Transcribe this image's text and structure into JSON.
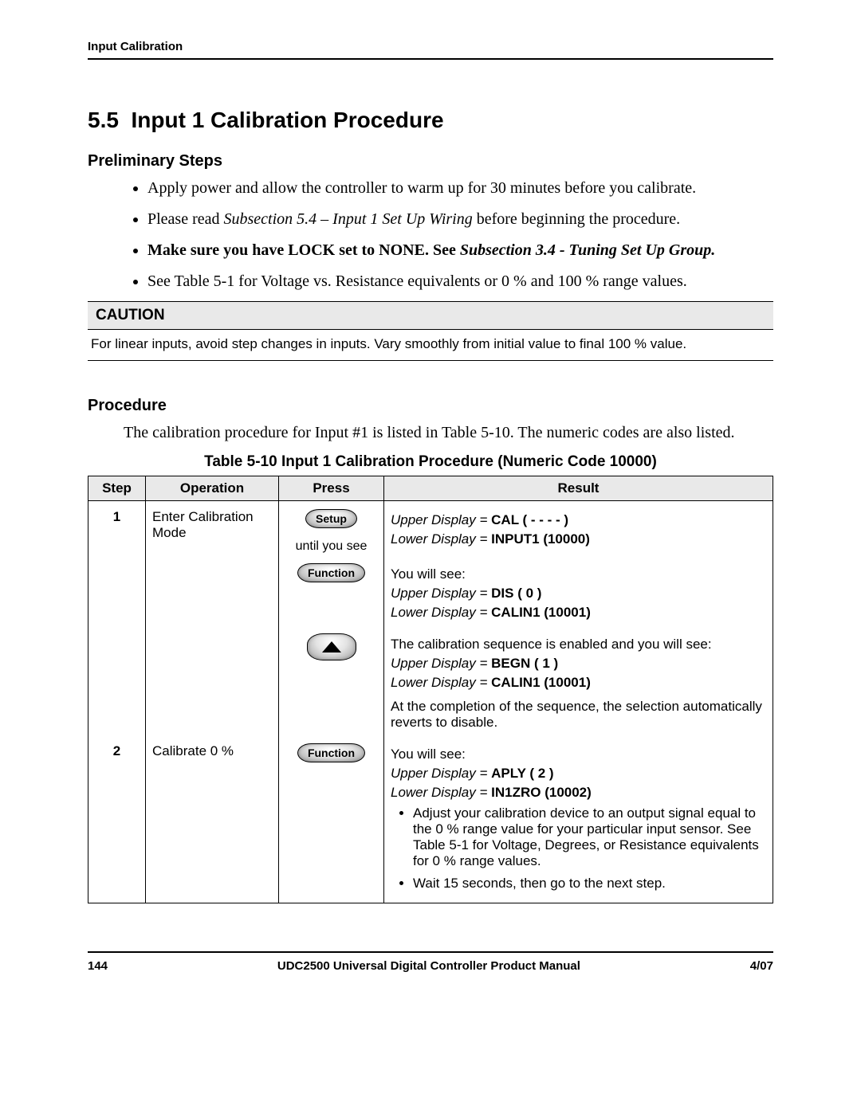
{
  "header": {
    "running": "Input Calibration"
  },
  "section": {
    "number": "5.5",
    "title": "Input 1 Calibration Procedure"
  },
  "prelim": {
    "heading": "Preliminary Steps",
    "b1": "Apply power and allow the controller to warm up for 30 minutes before you calibrate.",
    "b2_a": "Please read ",
    "b2_i": "Subsection 5.4 – Input 1 Set Up Wiring",
    "b2_b": " before beginning the procedure.",
    "b3_a": "Make sure you have LOCK set to NONE. See ",
    "b3_i": "Subsection 3.4 - Tuning Set Up Group.",
    "b4": "See Table 5-1 for Voltage vs. Resistance equivalents or 0 % and 100 % range values."
  },
  "caution": {
    "label": "CAUTION",
    "body": "For linear inputs, avoid step changes in inputs. Vary smoothly from initial value to final 100 % value."
  },
  "procedure": {
    "heading": "Procedure",
    "intro": "The calibration procedure for Input #1 is listed in Table 5-10. The numeric codes are also listed.",
    "table_caption": "Table 5-10  Input 1 Calibration Procedure (Numeric Code 10000)"
  },
  "table": {
    "hdr_step": "Step",
    "hdr_op": "Operation",
    "hdr_press": "Press",
    "hdr_result": "Result"
  },
  "buttons": {
    "setup": "Setup",
    "function": "Function",
    "up_name": "up-arrow-button"
  },
  "row1": {
    "step": "1",
    "op": "Enter Calibration Mode",
    "until": "until you see",
    "res1_a": "Upper Display = ",
    "res1_b": "CAL ( - - - - )",
    "res1_c": "Lower Display = ",
    "res1_d": "INPUT1 (10000)",
    "res2_a": "You will see:",
    "res2_b": "Upper Display = ",
    "res2_c": "DIS ( 0 )",
    "res2_d": "Lower Display = ",
    "res2_e": "CALIN1 (10001)",
    "res3_a": "The calibration sequence is enabled and you will see:",
    "res3_b": "Upper Display = ",
    "res3_c": "BEGN ( 1 )",
    "res3_d": "Lower Display = ",
    "res3_e": "CALIN1 (10001)",
    "res3_f": "At the completion of the sequence, the selection automatically reverts to disable."
  },
  "row2": {
    "step": "2",
    "op": "Calibrate 0 %",
    "res_a": "You will see:",
    "res_b": "Upper Display = ",
    "res_c": "APLY ( 2 )",
    "res_d": "Lower Display = ",
    "res_e": "IN1ZRO (10002)",
    "li1": "Adjust your calibration device to an output signal equal to the 0 % range value for your particular input sensor. See Table 5-1 for Voltage, Degrees, or Resistance equivalents for 0 % range values.",
    "li2": "Wait 15 seconds, then go to the next step."
  },
  "footer": {
    "page": "144",
    "title": "UDC2500 Universal Digital Controller Product Manual",
    "date": "4/07"
  }
}
